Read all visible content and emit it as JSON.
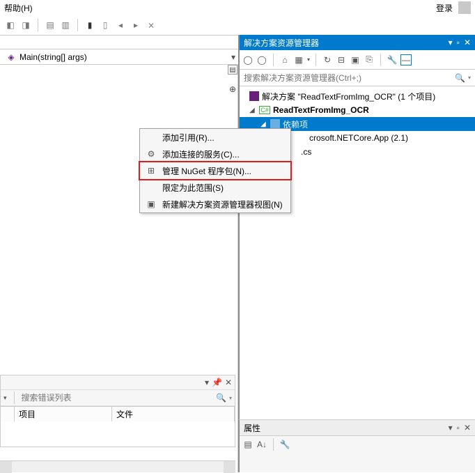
{
  "menubar": {
    "help": "帮助(H)",
    "login": "登录"
  },
  "code": {
    "main_signature": "Main(string[] args)"
  },
  "solutionExplorer": {
    "title": "解决方案资源管理器",
    "search_placeholder": "搜索解决方案资源管理器(Ctrl+;)",
    "solution_line": "解决方案 \"ReadTextFromImg_OCR\" (1 个项目)",
    "project_name": "ReadTextFromImg_OCR",
    "dependency_label": "crosoft.NETCore.App (2.1)",
    "cs_file": ".cs"
  },
  "contextMenu": {
    "items": [
      {
        "label": "添加引用(R)...",
        "icon": ""
      },
      {
        "label": "添加连接的服务(C)...",
        "icon": "⚙"
      },
      {
        "label": "管理 NuGet 程序包(N)...",
        "icon": "⊞"
      },
      {
        "label": "限定为此范围(S)",
        "icon": ""
      },
      {
        "label": "新建解决方案资源管理器视图(N)",
        "icon": "▣"
      }
    ]
  },
  "errorList": {
    "search_placeholder": "搜索错误列表",
    "columns": {
      "project": "项目",
      "file": "文件"
    }
  },
  "properties": {
    "title": "属性"
  }
}
